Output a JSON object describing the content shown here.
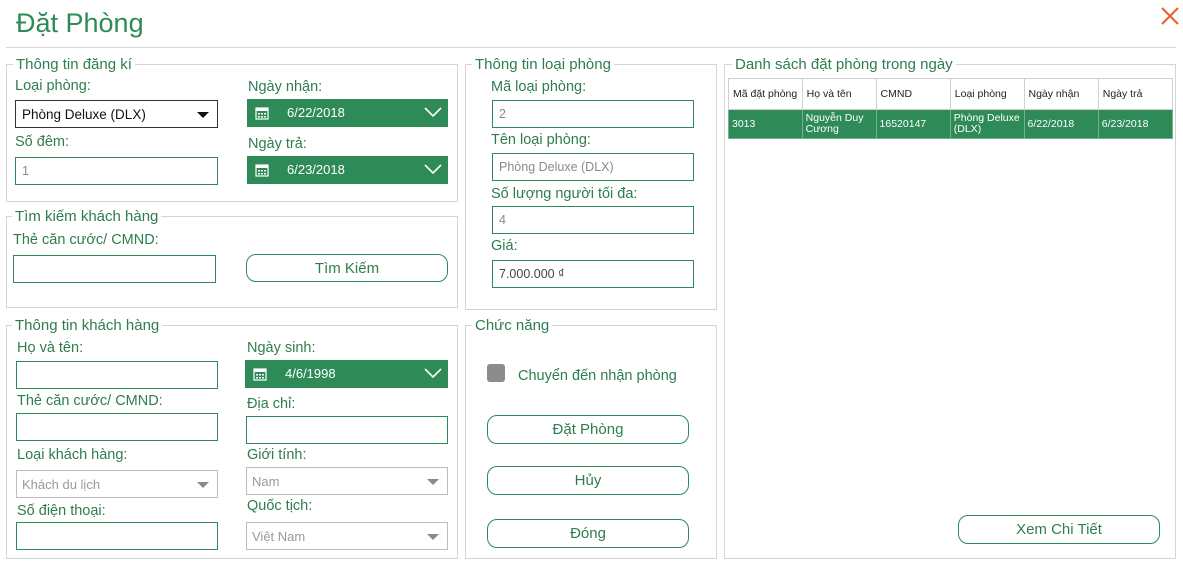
{
  "window": {
    "title": "Đặt Phòng"
  },
  "registration": {
    "legend": "Thông tin đăng kí",
    "room_type_label": "Loại phòng:",
    "room_type_value": "Phòng Deluxe (DLX)",
    "nights_label": "Số đêm:",
    "nights_value": "1",
    "checkin_label": "Ngày nhận:",
    "checkin_value": "6/22/2018",
    "checkout_label": "Ngày trả:",
    "checkout_value": "6/23/2018"
  },
  "search": {
    "legend": "Tìm kiếm khách hàng",
    "id_label": "Thẻ căn cước/ CMND:",
    "id_value": "",
    "button": "Tìm Kiếm"
  },
  "customer": {
    "legend": "Thông tin khách hàng",
    "name_label": "Họ và tên:",
    "name_value": "",
    "dob_label": "Ngày sinh:",
    "dob_value": "4/6/1998",
    "id_label": "Thẻ căn cước/ CMND:",
    "id_value": "",
    "address_label": "Địa chỉ:",
    "address_value": "",
    "type_label": "Loại khách hàng:",
    "type_value": "Khách du lịch",
    "gender_label": "Giới tính:",
    "gender_value": "Nam",
    "phone_label": "Số điện thoại:",
    "phone_value": "",
    "nationality_label": "Quốc tịch:",
    "nationality_value": "Việt Nam"
  },
  "room_info": {
    "legend": "Thông tin loại phòng",
    "code_label": "Mã loại phòng:",
    "code_value": "2",
    "name_label": "Tên loại phòng:",
    "name_value": "Phòng Deluxe (DLX)",
    "max_label": "Số lượng người tối đa:",
    "max_value": "4",
    "price_label": "Giá:",
    "price_value": "7.000.000 ₫"
  },
  "functions": {
    "legend": "Chức năng",
    "checkbox_label": "Chuyển đến nhận phòng",
    "book_button": "Đặt Phòng",
    "cancel_button": "Hủy",
    "close_button": "Đóng"
  },
  "bookings": {
    "legend": "Danh sách đặt phòng trong ngày",
    "headers": [
      "Mã đặt phòng",
      "Họ và tên",
      "CMND",
      "Loại phòng",
      "Ngày nhận",
      "Ngày trả"
    ],
    "rows": [
      [
        "3013",
        "Nguyễn Duy Cương",
        "16520147",
        "Phòng Deluxe (DLX)",
        "6/22/2018",
        "6/23/2018"
      ]
    ],
    "detail_button": "Xem Chi Tiết"
  },
  "colors": {
    "accent": "#2e8b57",
    "close": "#e8602c"
  },
  "icons": {
    "close": "close-icon",
    "calendar": "calendar-icon",
    "dropdown": "chevron-down-icon"
  }
}
